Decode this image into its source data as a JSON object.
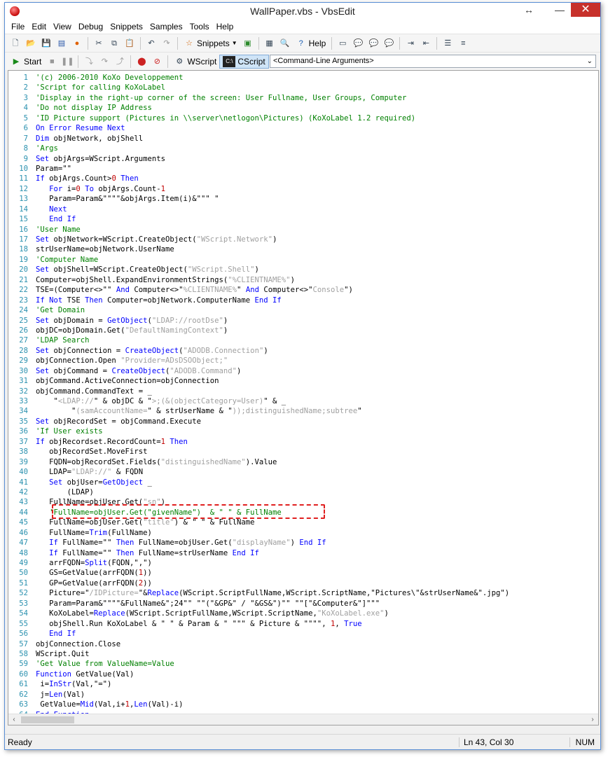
{
  "window": {
    "title": "WallPaper.vbs - VbsEdit",
    "restore_glyph": "↔",
    "min_glyph": "—",
    "close_glyph": "✕"
  },
  "menu": [
    "File",
    "Edit",
    "View",
    "Debug",
    "Snippets",
    "Samples",
    "Tools",
    "Help"
  ],
  "toolbar1": {
    "snippets_label": "Snippets",
    "help_label": "Help"
  },
  "toolbar2": {
    "start_label": "Start",
    "wscript_label": "WScript",
    "cscript_label": "CScript",
    "args_text": "<Command-Line Arguments>"
  },
  "status": {
    "ready": "Ready",
    "position": "Ln 43, Col 30",
    "num": "NUM"
  },
  "colors": {
    "keyword": "#0000ff",
    "comment": "#008000",
    "string": "#a0a0a0",
    "number": "#c00000",
    "line_number": "#2b91af",
    "highlight_border": "#e02020"
  },
  "code_lines": [
    [
      [
        "c",
        "'(c) 2006-2010 KoXo Developpement"
      ]
    ],
    [
      [
        "c",
        "'Script for calling KoXoLabel"
      ]
    ],
    [
      [
        "c",
        "'Display in the right-up corner of the screen: User Fullname, User Groups, Computer"
      ]
    ],
    [
      [
        "c",
        "'Do not display IP Address"
      ]
    ],
    [
      [
        "c",
        "'ID Picture support (Pictures in \\\\server\\netlogon\\Pictures) (KoXoLabel 1.2 required)"
      ]
    ],
    [
      [
        "k",
        "On Error Resume Next"
      ]
    ],
    [
      [
        "k",
        "Dim"
      ],
      [
        "p",
        " objNetwork, objShell"
      ]
    ],
    [
      [
        "c",
        "'Args"
      ]
    ],
    [
      [
        "k",
        "Set"
      ],
      [
        "p",
        " objArgs=WScript.Arguments"
      ]
    ],
    [
      [
        "p",
        "Param=\"\""
      ]
    ],
    [
      [
        "k",
        "If"
      ],
      [
        "p",
        " objArgs.Count>"
      ],
      [
        "n",
        "0"
      ],
      [
        "p",
        " "
      ],
      [
        "k",
        "Then"
      ]
    ],
    [
      [
        "p",
        "   "
      ],
      [
        "k",
        "For"
      ],
      [
        "p",
        " i="
      ],
      [
        "n",
        "0"
      ],
      [
        "p",
        " "
      ],
      [
        "k",
        "To"
      ],
      [
        "p",
        " objArgs.Count-"
      ],
      [
        "n",
        "1"
      ]
    ],
    [
      [
        "p",
        "   Param=Param&\"\"\"\"&objArgs.Item(i)&\"\"\" \""
      ]
    ],
    [
      [
        "p",
        "   "
      ],
      [
        "k",
        "Next"
      ]
    ],
    [
      [
        "p",
        "   "
      ],
      [
        "k",
        "End If"
      ]
    ],
    [
      [
        "c",
        "'User Name"
      ]
    ],
    [
      [
        "k",
        "Set"
      ],
      [
        "p",
        " objNetwork=WScript.CreateObject("
      ],
      [
        "s",
        "\"WScript.Network\""
      ],
      [
        "p",
        ")"
      ]
    ],
    [
      [
        "p",
        "strUserName=objNetwork.UserName"
      ]
    ],
    [
      [
        "c",
        "'Computer Name"
      ]
    ],
    [
      [
        "k",
        "Set"
      ],
      [
        "p",
        " objShell=WScript.CreateObject("
      ],
      [
        "s",
        "\"WScript.Shell\""
      ],
      [
        "p",
        ")"
      ]
    ],
    [
      [
        "p",
        "Computer=objShell.ExpandEnvironmentStrings("
      ],
      [
        "s",
        "\"%CLIENTNAME%\""
      ],
      [
        "p",
        ")"
      ]
    ],
    [
      [
        "p",
        "TSE=(Computer<>\"\" "
      ],
      [
        "k",
        "And"
      ],
      [
        "p",
        " Computer<>\""
      ],
      [
        "s",
        "%CLIENTNAME%"
      ],
      [
        "p",
        "\" "
      ],
      [
        "k",
        "And"
      ],
      [
        "p",
        " Computer<>\""
      ],
      [
        "s",
        "Console"
      ],
      [
        "p",
        "\")"
      ]
    ],
    [
      [
        "k",
        "If Not"
      ],
      [
        "p",
        " TSE "
      ],
      [
        "k",
        "Then"
      ],
      [
        "p",
        " Computer=objNetwork.ComputerName "
      ],
      [
        "k",
        "End If"
      ]
    ],
    [
      [
        "c",
        "'Get Domain"
      ]
    ],
    [
      [
        "k",
        "Set"
      ],
      [
        "p",
        " objDomain = "
      ],
      [
        "k",
        "GetObject"
      ],
      [
        "p",
        "("
      ],
      [
        "s",
        "\"LDAP://rootDse\""
      ],
      [
        "p",
        ")"
      ]
    ],
    [
      [
        "p",
        "objDC=objDomain.Get("
      ],
      [
        "s",
        "\"DefaultNamingContext\""
      ],
      [
        "p",
        ")"
      ]
    ],
    [
      [
        "c",
        "'LDAP Search"
      ]
    ],
    [
      [
        "k",
        "Set"
      ],
      [
        "p",
        " objConnection = "
      ],
      [
        "k",
        "CreateObject"
      ],
      [
        "p",
        "("
      ],
      [
        "s",
        "\"ADODB.Connection\""
      ],
      [
        "p",
        ")"
      ]
    ],
    [
      [
        "p",
        "objConnection.Open "
      ],
      [
        "s",
        "\"Provider=ADsDSOObject;\""
      ]
    ],
    [
      [
        "k",
        "Set"
      ],
      [
        "p",
        " objCommand = "
      ],
      [
        "k",
        "CreateObject"
      ],
      [
        "p",
        "("
      ],
      [
        "s",
        "\"ADODB.Command\""
      ],
      [
        "p",
        ")"
      ]
    ],
    [
      [
        "p",
        "objCommand.ActiveConnection=objConnection"
      ]
    ],
    [
      [
        "p",
        "objCommand.CommandText = _"
      ]
    ],
    [
      [
        "p",
        "    \""
      ],
      [
        "s",
        "<LDAP://"
      ],
      [
        "p",
        "\" & objDC & \""
      ],
      [
        "s",
        ">;(&(objectCategory=User)"
      ],
      [
        "p",
        "\" & _"
      ]
    ],
    [
      [
        "p",
        "        \""
      ],
      [
        "s",
        "(samAccountName="
      ],
      [
        "p",
        "\" & strUserName & \""
      ],
      [
        "s",
        "));distinguishedName;subtree"
      ],
      [
        "p",
        "\""
      ]
    ],
    [
      [
        "k",
        "Set"
      ],
      [
        "p",
        " objRecordSet = objCommand.Execute"
      ]
    ],
    [
      [
        "c",
        "'If User exists"
      ]
    ],
    [
      [
        "k",
        "If"
      ],
      [
        "p",
        " objRecordset.RecordCount="
      ],
      [
        "n",
        "1"
      ],
      [
        "p",
        " "
      ],
      [
        "k",
        "Then"
      ]
    ],
    [
      [
        "p",
        "   objRecordSet.MoveFirst"
      ]
    ],
    [
      [
        "p",
        "   FQDN=objRecordSet.Fields("
      ],
      [
        "s",
        "\"distinguishedName\""
      ],
      [
        "p",
        ").Value"
      ]
    ],
    [
      [
        "p",
        "   LDAP="
      ],
      [
        "s",
        "\"LDAP://\""
      ],
      [
        "p",
        " & FQDN"
      ]
    ],
    [
      [
        "p",
        "   "
      ],
      [
        "k",
        "Set"
      ],
      [
        "p",
        " objUser="
      ],
      [
        "k",
        "GetObject"
      ],
      [
        "p",
        " _"
      ]
    ],
    [
      [
        "p",
        "       (LDAP)"
      ]
    ],
    [
      [
        "p",
        "   FullName=objUser.Get("
      ],
      [
        "s",
        "\"sn\""
      ],
      [
        "p",
        ")"
      ]
    ],
    [
      [
        "p",
        "   "
      ],
      [
        "c",
        "'FullName=objUser.Get(\"givenName\")  & \" \" & FullName"
      ]
    ],
    [
      [
        "p",
        "   FullName=objUser.Get("
      ],
      [
        "s",
        "\"title\""
      ],
      [
        "p",
        ") & \" \" & FullName"
      ]
    ],
    [
      [
        "p",
        "   FullName="
      ],
      [
        "k",
        "Trim"
      ],
      [
        "p",
        "(FullName)"
      ]
    ],
    [
      [
        "p",
        "   "
      ],
      [
        "k",
        "If"
      ],
      [
        "p",
        " FullName=\"\" "
      ],
      [
        "k",
        "Then"
      ],
      [
        "p",
        " FullName=objUser.Get("
      ],
      [
        "s",
        "\"displayName\""
      ],
      [
        "p",
        ") "
      ],
      [
        "k",
        "End If"
      ]
    ],
    [
      [
        "p",
        "   "
      ],
      [
        "k",
        "If"
      ],
      [
        "p",
        " FullName=\"\" "
      ],
      [
        "k",
        "Then"
      ],
      [
        "p",
        " FullName=strUserName "
      ],
      [
        "k",
        "End If"
      ]
    ],
    [
      [
        "p",
        "   arrFQDN="
      ],
      [
        "k",
        "Split"
      ],
      [
        "p",
        "(FQDN,\",\")"
      ]
    ],
    [
      [
        "p",
        "   GS=GetValue(arrFQDN("
      ],
      [
        "n",
        "1"
      ],
      [
        "p",
        "))"
      ]
    ],
    [
      [
        "p",
        "   GP=GetValue(arrFQDN("
      ],
      [
        "n",
        "2"
      ],
      [
        "p",
        "))"
      ]
    ],
    [
      [
        "p",
        "   Picture=\""
      ],
      [
        "s",
        "/IDPicture="
      ],
      [
        "p",
        "\"&"
      ],
      [
        "k",
        "Replace"
      ],
      [
        "p",
        "(WScript.ScriptFullName,WScript.ScriptName,\"Pictures\\\"&strUserName&\".jpg\")"
      ]
    ],
    [
      [
        "p",
        "   Param=Param&\"\"\"\"&FullName&\";24\"\" \"\"(\"&GP&\" / \"&GS&\")\"\" \"\"[\"&Computer&\"]\"\"\""
      ]
    ],
    [
      [
        "p",
        "   KoXoLabel="
      ],
      [
        "k",
        "Replace"
      ],
      [
        "p",
        "(WScript.ScriptFullName,WScript.ScriptName,"
      ],
      [
        "s",
        "\"KoXoLabel.exe\""
      ],
      [
        "p",
        ")"
      ]
    ],
    [
      [
        "p",
        "   objShell.Run KoXoLabel & \" \" & Param & \" \"\"\" & Picture & \"\"\"\", "
      ],
      [
        "n",
        "1"
      ],
      [
        "p",
        ", "
      ],
      [
        "k",
        "True"
      ]
    ],
    [
      [
        "p",
        "   "
      ],
      [
        "k",
        "End If"
      ]
    ],
    [
      [
        "p",
        "objConnection.Close"
      ]
    ],
    [
      [
        "p",
        "WScript.Quit"
      ]
    ],
    [
      [
        "c",
        "'Get Value from ValueName=Value"
      ]
    ],
    [
      [
        "k",
        "Function"
      ],
      [
        "p",
        " GetValue(Val)"
      ]
    ],
    [
      [
        "p",
        " i="
      ],
      [
        "k",
        "InStr"
      ],
      [
        "p",
        "(Val,\"=\")"
      ]
    ],
    [
      [
        "p",
        " j="
      ],
      [
        "k",
        "Len"
      ],
      [
        "p",
        "(Val)"
      ]
    ],
    [
      [
        "p",
        " GetValue="
      ],
      [
        "k",
        "Mid"
      ],
      [
        "p",
        "(Val,i+"
      ],
      [
        "n",
        "1"
      ],
      [
        "p",
        ","
      ],
      [
        "k",
        "Len"
      ],
      [
        "p",
        "(Val)-i)"
      ]
    ],
    [
      [
        "k",
        "End Function"
      ]
    ]
  ]
}
